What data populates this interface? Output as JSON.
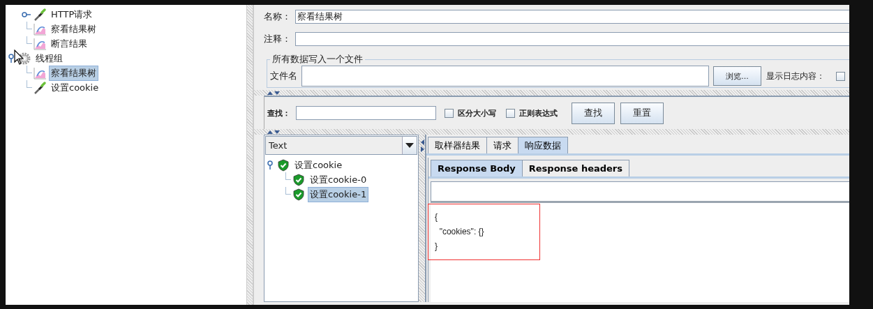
{
  "test_plan_tree": [
    {
      "kind": "cut_off",
      "children": [
        {
          "label": "HTTP请求",
          "kind": "sampler",
          "expanded": false,
          "selected": false
        },
        {
          "label": "察看结果树",
          "kind": "listener",
          "selected": false
        },
        {
          "label": "断言结果",
          "kind": "listener",
          "selected": false
        }
      ]
    },
    {
      "label": "线程组",
      "kind": "thread_group",
      "expanded": true,
      "selected": false,
      "children": [
        {
          "label": "察看结果树",
          "kind": "listener",
          "selected": true
        },
        {
          "label": "设置cookie",
          "kind": "sampler",
          "selected": false
        }
      ]
    }
  ],
  "pointer": {
    "kind": "arrow"
  },
  "name_field": {
    "label": "名称：",
    "value": "察看结果树"
  },
  "comment_field": {
    "label": "注释："
  },
  "file_group": {
    "title": "所有数据写入一个文件",
    "filename_label": "文件名",
    "browse_button": "浏览...",
    "log_label": "显示日志内容：",
    "log_checked": false
  },
  "search": {
    "label": "查找：",
    "options": [
      {
        "label": "区分大小写",
        "checked": false
      },
      {
        "label": "正则表达式",
        "checked": false
      }
    ],
    "buttons": [
      "查找",
      "重置"
    ]
  },
  "results": {
    "renderer": "Text",
    "tree": [
      {
        "label": "设置cookie",
        "kind": "success",
        "expanded": true,
        "selected": false,
        "children": [
          {
            "label": "设置cookie-0",
            "kind": "success",
            "selected": false
          },
          {
            "label": "设置cookie-1",
            "kind": "success",
            "selected": true
          }
        ]
      }
    ],
    "tabs": [
      {
        "label": "取样器结果",
        "selected": false
      },
      {
        "label": "请求",
        "selected": false
      },
      {
        "label": "响应数据",
        "selected": true
      }
    ],
    "sub_tabs": [
      {
        "label": "Response Body",
        "selected": true
      },
      {
        "label": "Response headers",
        "selected": false
      }
    ],
    "response_text": "{\n  \"cookies\": {}\n}",
    "response_highlighted": true
  }
}
